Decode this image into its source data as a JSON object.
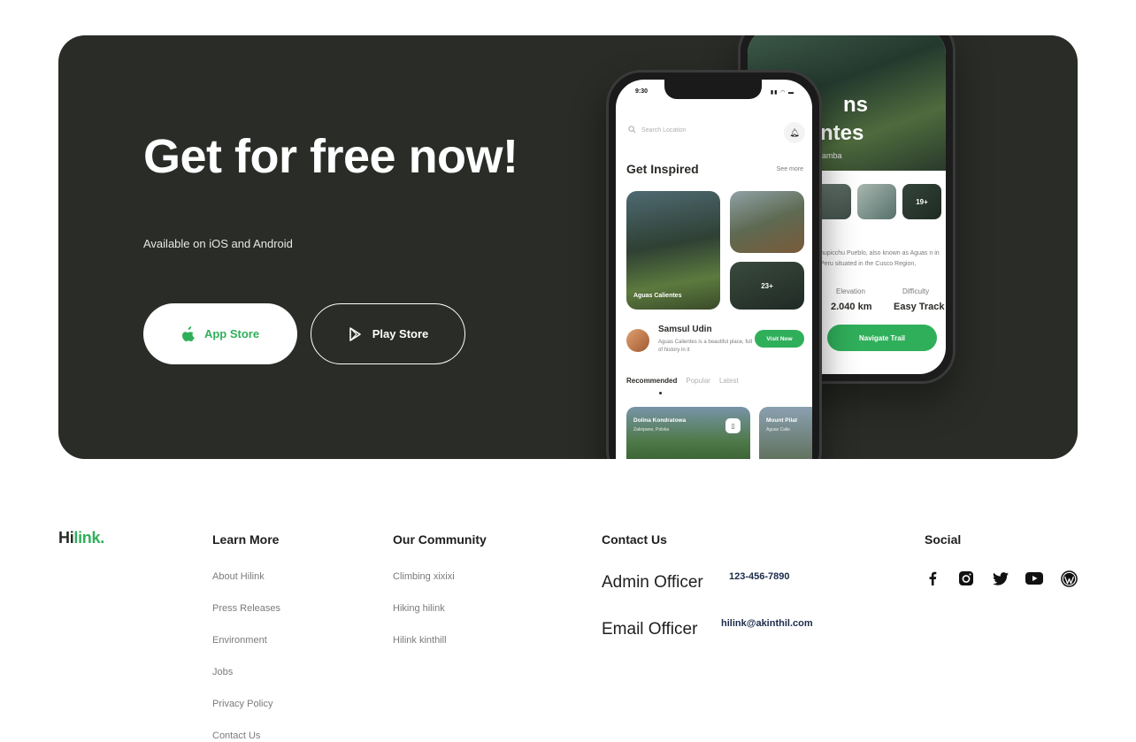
{
  "hero": {
    "title": "Get for free now!",
    "subtitle": "Available on iOS and Android",
    "app_store_label": "App Store",
    "play_store_label": "Play Store",
    "accent_color": "#30af5b",
    "background_color": "#292c27"
  },
  "phone_back": {
    "hero_line1": "ns",
    "hero_line2": "ntes",
    "hero_line3": "amba",
    "thumb_count": "19+",
    "description": "hupicchu Pueblo, also known as Aguas n in Peru situated in the Cusco Region,",
    "stat1_label": "Elevation",
    "stat1_value": "2.040 km",
    "stat2_label": "Difficulty",
    "stat2_value": "Easy Track",
    "button_label": "Navigate Trail"
  },
  "phone_front": {
    "time": "9:30",
    "search_placeholder": "Search Location",
    "heading": "Get Inspired",
    "see_more": "See more",
    "card_label": "Aguas Calientes",
    "card_count": "23+",
    "profile_name": "Samsul Udin",
    "profile_desc": "Aguas Calientes is a beautiful place, full of history in it",
    "visit_button": "Visit Now",
    "tabs": [
      "Recommended",
      "Popular",
      "Latest"
    ],
    "rec1_title": "Dolina Kondratowa",
    "rec1_sub": "Zakopane, Polska",
    "rec2_title": "Mount Pilat",
    "rec2_sub": "Aguas Calie"
  },
  "footer": {
    "logo_part1": "Hi",
    "logo_part2": "link.",
    "learn_more": {
      "title": "Learn More",
      "links": [
        "About Hilink",
        "Press Releases",
        "Environment",
        "Jobs",
        "Privacy Policy",
        "Contact Us"
      ]
    },
    "community": {
      "title": "Our Community",
      "links": [
        "Climbing xixixi",
        "Hiking hilink",
        "Hilink kinthill"
      ]
    },
    "contact": {
      "title": "Contact Us",
      "admin_label": "Admin Officer",
      "admin_value": "123-456-7890",
      "email_label": "Email Officer",
      "email_value": "hilink@akinthil.com"
    },
    "social": {
      "title": "Social",
      "icons": [
        "facebook-icon",
        "instagram-icon",
        "twitter-icon",
        "youtube-icon",
        "wordpress-icon"
      ]
    }
  }
}
